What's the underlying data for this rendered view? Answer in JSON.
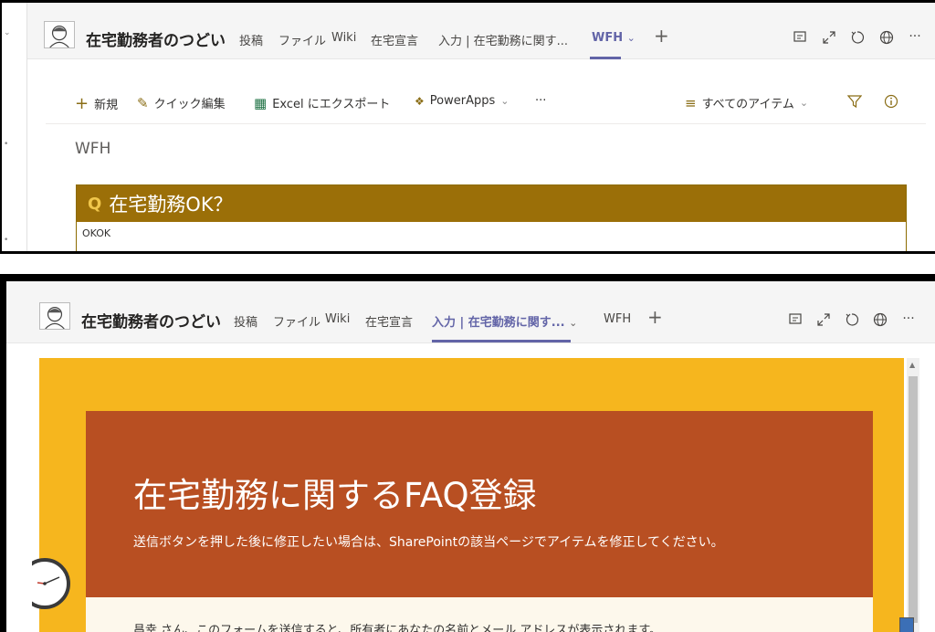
{
  "top_panel": {
    "header": {
      "team_name": "在宅勤務者のつどい",
      "tabs": [
        {
          "label": "投稿"
        },
        {
          "label": "ファイル"
        },
        {
          "label": "Wiki"
        },
        {
          "label": "在宅宣言"
        },
        {
          "label": "入力 | 在宅勤務に関す..."
        },
        {
          "label": "WFH"
        }
      ],
      "active_tab": "WFH",
      "add_tab": "+",
      "more": "···"
    },
    "toolbar": {
      "new_label": "新規",
      "quick_edit_label": "クイック編集",
      "export_label": "Excel にエクスポート",
      "powerapps_label": "PowerApps",
      "more_label": "···",
      "view_label": "すべてのアイテム",
      "new_icon": "plus-icon",
      "filter_icon": "filter-icon",
      "info_icon": "info-icon"
    },
    "view_title": "WFH",
    "faq": {
      "marker": "Q",
      "question": "在宅勤務OK？",
      "answer": "OKOK"
    }
  },
  "bottom_panel": {
    "header": {
      "team_name": "在宅勤務者のつどい",
      "tabs": [
        {
          "label": "投稿"
        },
        {
          "label": "ファイル"
        },
        {
          "label": "Wiki"
        },
        {
          "label": "在宅宣言"
        },
        {
          "label": "入力 | 在宅勤務に関す..."
        },
        {
          "label": "WFH"
        }
      ],
      "active_tab": "入力 | 在宅勤務に関す...",
      "add_tab": "+",
      "more": "···"
    },
    "form": {
      "title": "在宅勤務に関するFAQ登録",
      "subtitle": "送信ボタンを押した後に修正したい場合は、SharePointの該当ページでアイテムを修正してください。",
      "notice": "昌幸 さん、このフォームを送信すると、所有者にあなたの名前とメール アドレスが表示されます。"
    }
  },
  "colors": {
    "teams_accent": "#6264a7",
    "faq_header": "#9b6f08",
    "form_outer": "#f6b61e",
    "form_header": "#b84f22"
  }
}
